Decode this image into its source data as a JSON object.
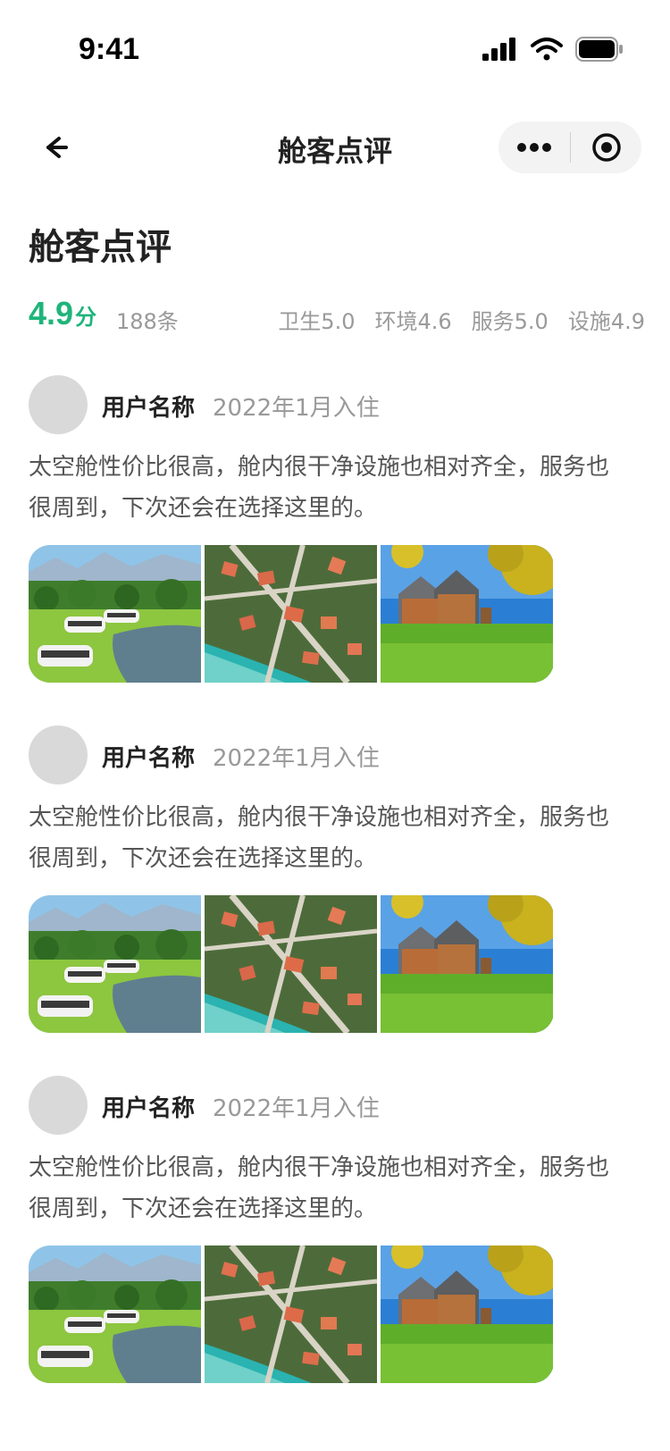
{
  "status_bar": {
    "time": "9:41",
    "icons": [
      "signal-icon",
      "wifi-icon",
      "battery-icon"
    ]
  },
  "nav": {
    "title": "舱客点评",
    "back_icon": "back-arrow-icon",
    "capsule_icons": [
      "more-dots-icon",
      "target-icon"
    ]
  },
  "header": {
    "page_title": "舱客点评",
    "score": "4.9",
    "score_unit": "分",
    "review_count": "188条",
    "subscores": [
      "卫生5.0",
      "环境4.6",
      "服务5.0",
      "设施4.9"
    ]
  },
  "colors": {
    "accent": "#1fb47a",
    "muted_text": "#999999",
    "avatar_placeholder": "#d9d9d9"
  },
  "reviews": [
    {
      "user_name": "用户名称",
      "stay_date": "2022年1月入住",
      "text": "太空舱性价比很高，舱内很干净设施也相对齐全，服务也很周到，下次还会在选择这里的。",
      "photos": [
        "camp-pods-lake-photo",
        "aerial-town-photo",
        "wooden-house-autumn-photo"
      ]
    },
    {
      "user_name": "用户名称",
      "stay_date": "2022年1月入住",
      "text": "太空舱性价比很高，舱内很干净设施也相对齐全，服务也很周到，下次还会在选择这里的。",
      "photos": [
        "camp-pods-lake-photo",
        "aerial-town-photo",
        "wooden-house-autumn-photo"
      ]
    },
    {
      "user_name": "用户名称",
      "stay_date": "2022年1月入住",
      "text": "太空舱性价比很高，舱内很干净设施也相对齐全，服务也很周到，下次还会在选择这里的。",
      "photos": [
        "camp-pods-lake-photo",
        "aerial-town-photo",
        "wooden-house-autumn-photo"
      ]
    }
  ]
}
